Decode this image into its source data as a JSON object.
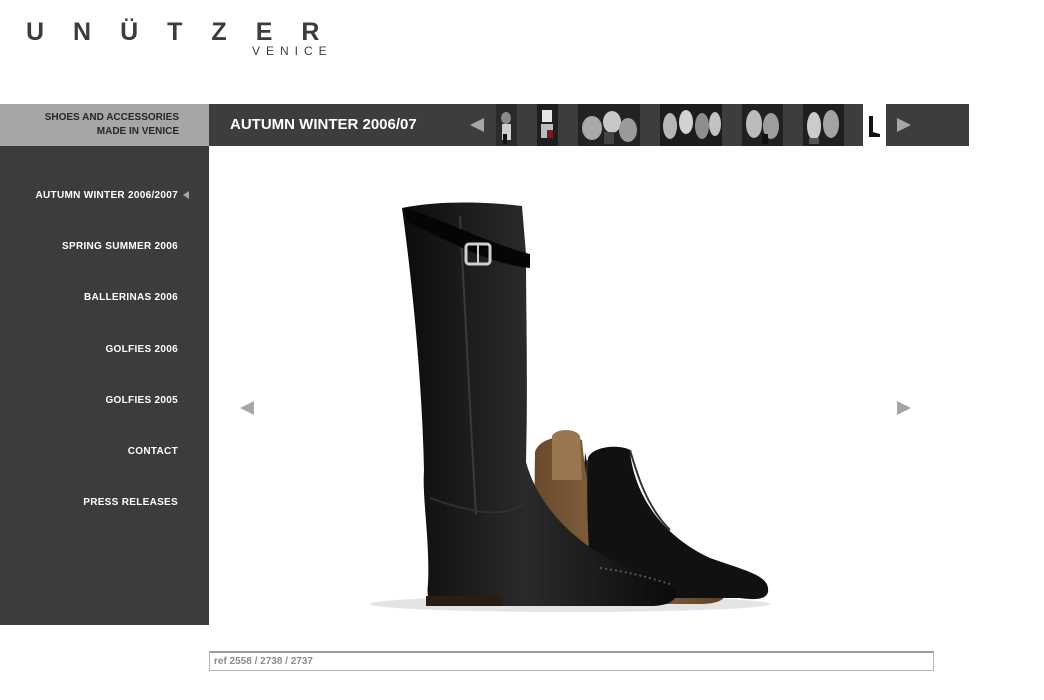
{
  "brand": {
    "name": "UNÜTZER",
    "subtitle": "VENICE"
  },
  "tagline": {
    "line1": "SHOES AND ACCESSORIES",
    "line2": "MADE IN VENICE"
  },
  "gallery": {
    "title": "AUTUMN WINTER 2006/07",
    "prev_icon": "triangle-left-icon",
    "next_icon": "triangle-right-icon",
    "thumbnail_count": 7,
    "active_thumbnail": 7
  },
  "nav": {
    "items": [
      {
        "label": "AUTUMN WINTER 2006/2007",
        "active": true
      },
      {
        "label": "SPRING SUMMER 2006",
        "active": false
      },
      {
        "label": "BALLERINAS 2006",
        "active": false
      },
      {
        "label": "GOLFIES 2006",
        "active": false
      },
      {
        "label": "GOLFIES 2005",
        "active": false
      },
      {
        "label": "CONTACT",
        "active": false
      },
      {
        "label": "PRESS RELEASES",
        "active": false
      }
    ]
  },
  "product": {
    "ref": "ref 2558 / 2738 / 2737"
  },
  "colors": {
    "sidebar": "#3c3c3c",
    "tagline_bg": "#a6a6a6",
    "topbar": "#3d3d3d",
    "text_light": "#ffffff",
    "arrow_gray": "#a6a6a6"
  }
}
